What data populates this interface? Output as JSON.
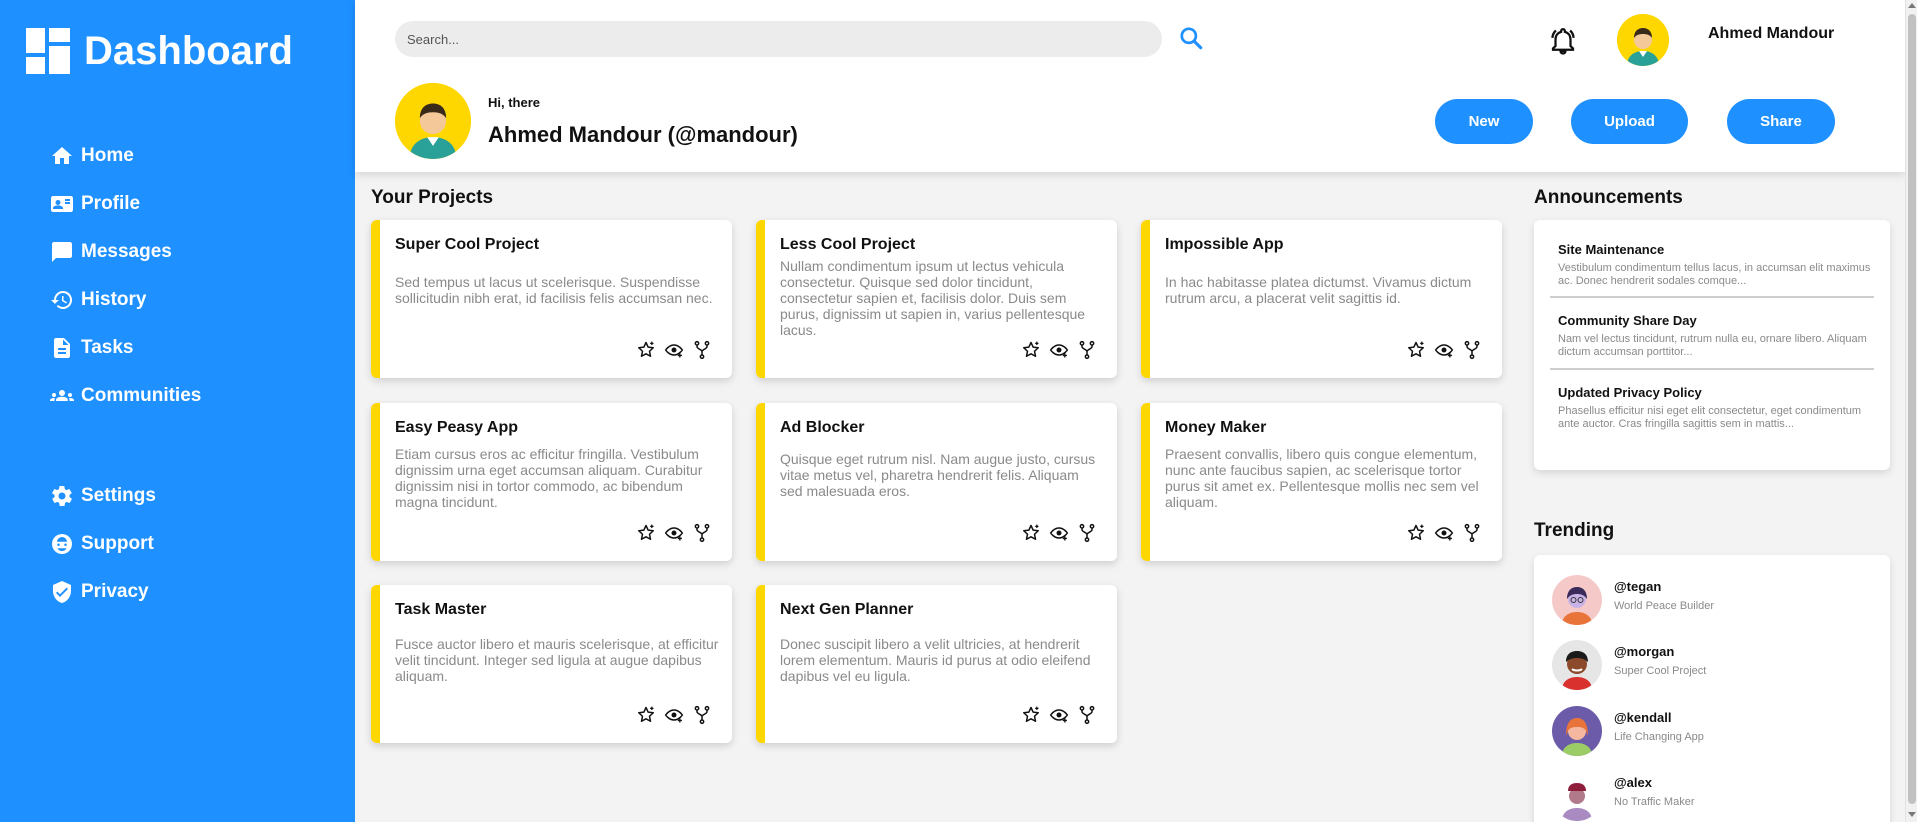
{
  "brand": {
    "title": "Dashboard"
  },
  "nav": {
    "primary": [
      {
        "label": "Home",
        "icon": "home-icon"
      },
      {
        "label": "Profile",
        "icon": "id-card-icon"
      },
      {
        "label": "Messages",
        "icon": "message-icon"
      },
      {
        "label": "History",
        "icon": "history-icon"
      },
      {
        "label": "Tasks",
        "icon": "document-icon"
      },
      {
        "label": "Communities",
        "icon": "people-icon"
      }
    ],
    "secondary": [
      {
        "label": "Settings",
        "icon": "gear-icon"
      },
      {
        "label": "Support",
        "icon": "support-icon"
      },
      {
        "label": "Privacy",
        "icon": "shield-icon"
      }
    ]
  },
  "header": {
    "search_placeholder": "Search...",
    "user_name": "Ahmed Mandour",
    "greeting": "Hi, there",
    "handle": "Ahmed Mandour (@mandour)",
    "buttons": {
      "new": "New",
      "upload": "Upload",
      "share": "Share"
    }
  },
  "projects": {
    "title": "Your Projects",
    "items": [
      {
        "title": "Super Cool Project",
        "description": "Sed tempus ut lacus ut scelerisque. Suspendisse sollicitudin nibh erat, id facilisis felis accumsan nec."
      },
      {
        "title": "Less Cool Project",
        "description": "Nullam condimentum ipsum ut lectus vehicula consectetur. Quisque sed dolor tincidunt, consectetur sapien et, facilisis dolor. Duis sem purus, dignissim ut sapien in, varius pellentesque lacus."
      },
      {
        "title": "Impossible App",
        "description": "In hac habitasse platea dictumst. Vivamus dictum rutrum arcu, a placerat velit sagittis id."
      },
      {
        "title": "Easy Peasy App",
        "description": "Etiam cursus eros ac efficitur fringilla. Vestibulum dignissim urna eget accumsan aliquam. Curabitur dignissim nisi in tortor commodo, ac bibendum magna tincidunt."
      },
      {
        "title": "Ad Blocker",
        "description": "Quisque eget rutrum nisl. Nam augue justo, cursus vitae metus vel, pharetra hendrerit felis. Aliquam sed malesuada eros."
      },
      {
        "title": "Money Maker",
        "description": "Praesent convallis, libero quis congue elementum, nunc ante faucibus sapien, ac scelerisque tortor purus sit amet ex. Pellentesque mollis nec sem vel aliquam."
      },
      {
        "title": "Task Master",
        "description": "Fusce auctor libero et mauris scelerisque, at efficitur velit tincidunt. Integer sed ligula at augue dapibus aliquam."
      },
      {
        "title": "Next Gen Planner",
        "description": "Donec suscipit libero a velit ultricies, at hendrerit lorem elementum. Mauris id purus at odio eleifend dapibus vel eu ligula."
      }
    ]
  },
  "announcements": {
    "title": "Announcements",
    "items": [
      {
        "title": "Site Maintenance",
        "text": "Vestibulum condimentum tellus lacus, in accumsan elit maximus ac. Donec hendrerit sodales comque..."
      },
      {
        "title": "Community Share Day",
        "text": "Nam vel lectus tincidunt, rutrum nulla eu, ornare libero. Aliquam dictum accumsan porttitor..."
      },
      {
        "title": "Updated Privacy Policy",
        "text": "Phasellus efficitur nisi eget elit consectetur, eget condimentum ante auctor. Cras fringilla sagittis sem in mattis..."
      }
    ]
  },
  "trending": {
    "title": "Trending",
    "items": [
      {
        "handle": "@tegan",
        "subtitle": "World Peace Builder"
      },
      {
        "handle": "@morgan",
        "subtitle": "Super Cool Project"
      },
      {
        "handle": "@kendall",
        "subtitle": "Life Changing App"
      },
      {
        "handle": "@alex",
        "subtitle": "No Traffic Maker"
      }
    ]
  },
  "colors": {
    "accent": "#1e90ff",
    "card_border": "#ffd700",
    "background": "#f3f3f3"
  }
}
